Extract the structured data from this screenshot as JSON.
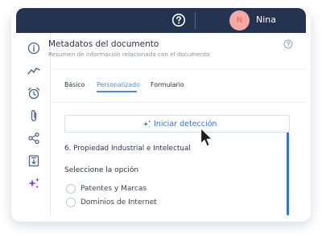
{
  "topbar": {
    "user_initial": "N",
    "user_name": "Nina",
    "icons": [
      "help-circle-icon"
    ]
  },
  "sidebar": {
    "items": [
      {
        "name": "info-icon"
      },
      {
        "name": "activity-icon"
      },
      {
        "name": "alarm-clock-icon"
      },
      {
        "name": "paperclip-icon"
      },
      {
        "name": "share-icon"
      },
      {
        "name": "download-icon"
      },
      {
        "name": "sparkles-icon"
      }
    ]
  },
  "header": {
    "title": "Metadatos del documento",
    "subtitle": "Resumen de información relacionada con el documento"
  },
  "tabs": [
    {
      "label": "Básico",
      "active": false
    },
    {
      "label": "Personalizado",
      "active": true
    },
    {
      "label": "Formulario",
      "active": false
    }
  ],
  "detect": {
    "label": "Iniciar detección",
    "icon": "sparkles-icon"
  },
  "section": {
    "title": "6. Propiedad Industrial e Intelectual"
  },
  "options": {
    "heading": "Seleccione la opción",
    "items": [
      {
        "label": "Patentes y Marcas",
        "selected": false
      },
      {
        "label": "Dominios de Internet",
        "selected": false
      }
    ]
  },
  "colors": {
    "topbar": "#233350",
    "accent": "#4a8de0",
    "avatar_bg": "#f6a8a4",
    "sparkle": "#8b3fd1"
  }
}
